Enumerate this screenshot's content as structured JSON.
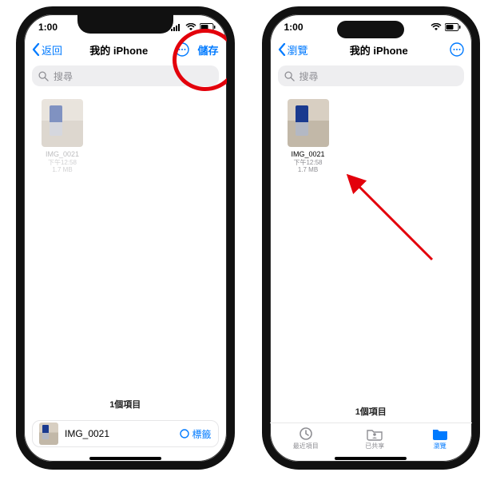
{
  "colors": {
    "accent": "#007aff",
    "annotation": "#e3000b"
  },
  "statusbar": {
    "time": "1:00"
  },
  "left": {
    "back_label": "返回",
    "title": "我的 iPhone",
    "save_label": "儲存",
    "search_placeholder": "搜尋",
    "file": {
      "name": "IMG_0021",
      "time": "下午12:58",
      "size": "1.7 MB"
    },
    "count_text": "1個項目",
    "action_filename": "IMG_0021",
    "tag_label": "標籤"
  },
  "right": {
    "back_label": "瀏覽",
    "title": "我的 iPhone",
    "search_placeholder": "搜尋",
    "file": {
      "name": "IMG_0021",
      "time": "下午12:58",
      "size": "1.7 MB"
    },
    "count_text": "1個項目",
    "tabs": {
      "recents": "最近項目",
      "shared": "已共享",
      "browse": "瀏覽"
    }
  }
}
